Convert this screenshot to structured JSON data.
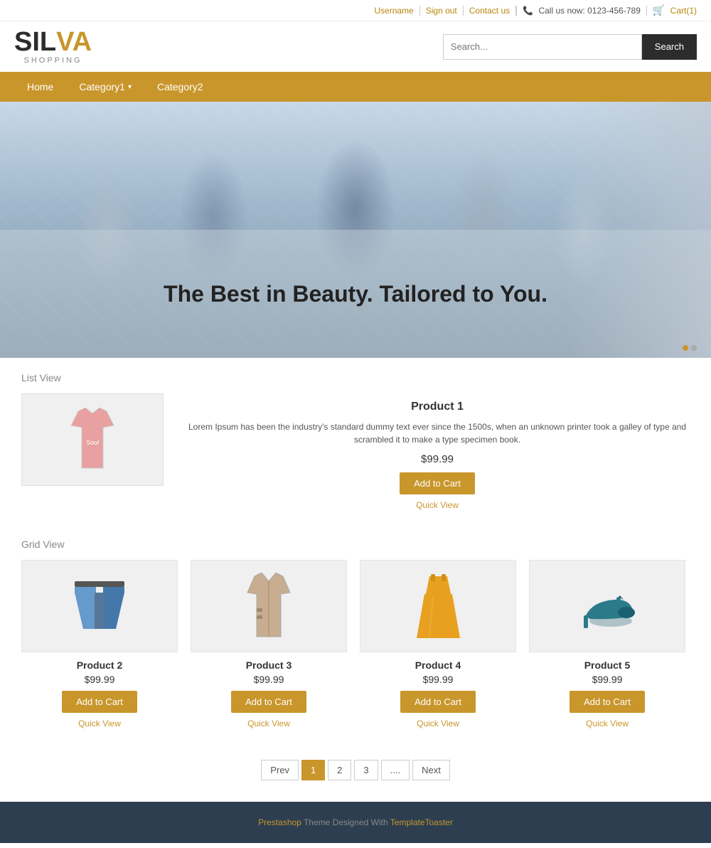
{
  "topbar": {
    "username": "Username",
    "signout": "Sign out",
    "contact": "Contact us",
    "phone_icon": "phone-icon",
    "phone_number": "Call us now: 0123-456-789",
    "cart_icon": "cart-icon",
    "cart": "Cart(1)"
  },
  "logo": {
    "sil": "SIL",
    "va": "VA",
    "shopping": "SHOPPING"
  },
  "search": {
    "placeholder": "Search...",
    "button_label": "Search"
  },
  "nav": {
    "items": [
      {
        "label": "Home",
        "has_dropdown": false
      },
      {
        "label": "Category1",
        "has_dropdown": true
      },
      {
        "label": "Category2",
        "has_dropdown": false
      }
    ]
  },
  "hero": {
    "text": "The Best in Beauty. Tailored to You.",
    "dots": [
      1,
      2
    ]
  },
  "list_view": {
    "section_title": "List View",
    "product": {
      "name": "Product 1",
      "description": "Lorem Ipsum has been the industry's standard dummy text ever since the 1500s, when an unknown printer took a galley of type and scrambled it to make a type specimen book.",
      "price": "$99.99",
      "add_to_cart": "Add to Cart",
      "quick_view": "Quick View"
    }
  },
  "grid_view": {
    "section_title": "Grid View",
    "products": [
      {
        "name": "Product 2",
        "price": "$99.99",
        "add_to_cart": "Add to Cart",
        "quick_view": "Quick View",
        "color": "#7bafd4",
        "shape": "shorts"
      },
      {
        "name": "Product 3",
        "price": "$99.99",
        "add_to_cart": "Add to Cart",
        "quick_view": "Quick View",
        "color": "#c8ad90",
        "shape": "jacket"
      },
      {
        "name": "Product 4",
        "price": "$99.99",
        "add_to_cart": "Add to Cart",
        "quick_view": "Quick View",
        "color": "#e8a020",
        "shape": "dress"
      },
      {
        "name": "Product 5",
        "price": "$99.99",
        "add_to_cart": "Add to Cart",
        "quick_view": "Quick View",
        "color": "#2a7a8a",
        "shape": "heels"
      }
    ]
  },
  "pagination": {
    "prev": "Prev",
    "pages": [
      "1",
      "2",
      "3",
      "...."
    ],
    "next": "Next",
    "active_page": "1"
  },
  "footer": {
    "text_prefix": "Prestashop",
    "text_middle": " Theme Designed With ",
    "text_brand": "TemplateToaster"
  }
}
